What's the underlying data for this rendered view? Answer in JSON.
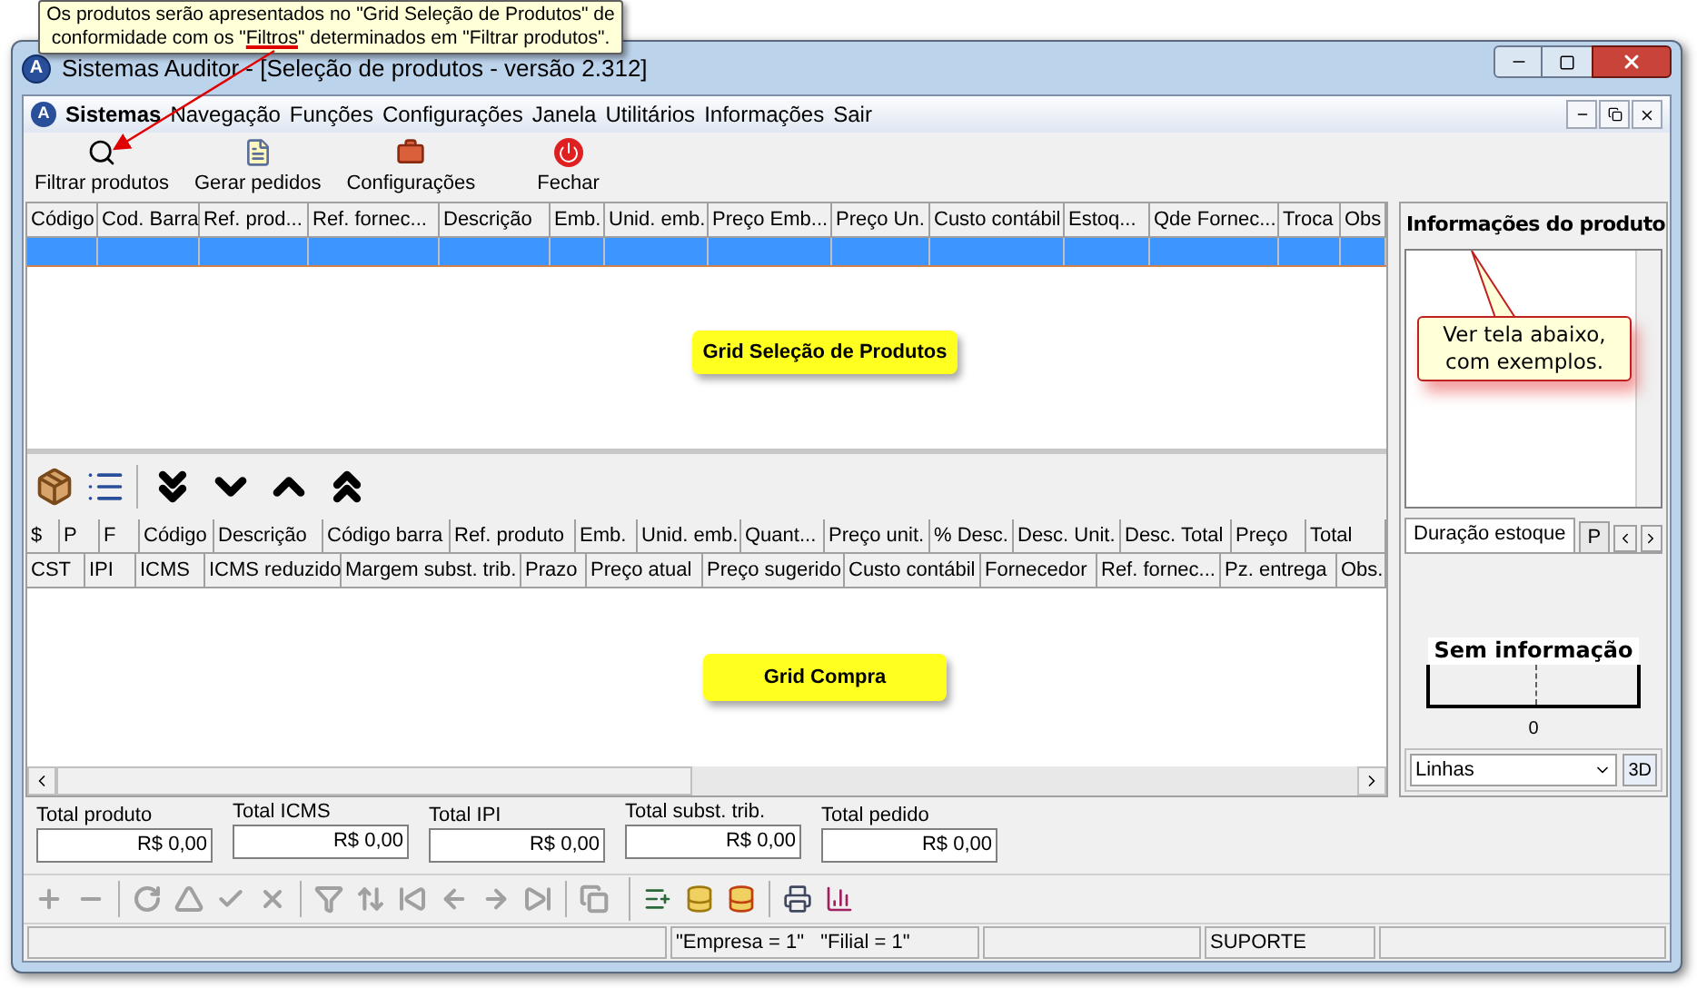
{
  "callout": {
    "parts": [
      {
        "text": "Os produtos serão apresentados no \"Grid Seleção de Produtos\" de conformidade com os \"",
        "underline": false
      },
      {
        "text": "Filtros",
        "underline": true
      },
      {
        "text": "\" determinados  em \"Filtrar produtos\".",
        "underline": false
      }
    ]
  },
  "window": {
    "logo": "A",
    "title": "Sistemas Auditor - [Seleção de produtos - versão 2.312]"
  },
  "menu_logo": "A",
  "menu": [
    {
      "label": "Sistemas",
      "bold": true
    },
    {
      "label": "Navegação",
      "bold": false
    },
    {
      "label": "Funções",
      "bold": false
    },
    {
      "label": "Configurações",
      "bold": false
    },
    {
      "label": "Janela",
      "bold": false
    },
    {
      "label": "Utilitários",
      "bold": false
    },
    {
      "label": "Informações",
      "bold": false
    },
    {
      "label": "Sair",
      "bold": false
    }
  ],
  "toolbar": [
    {
      "label": "Filtrar produtos",
      "kind": "search"
    },
    {
      "label": "Gerar pedidos",
      "kind": "new"
    },
    {
      "label": "Configurações",
      "kind": "settings"
    },
    {
      "label": "Fechar",
      "kind": "close"
    }
  ],
  "grid_selecao": {
    "columns": [
      "Código",
      "Cod. Barra",
      "Ref. prod...",
      "Ref. fornec...",
      "Descrição",
      "Emb.",
      "Unid. emb.",
      "Preço Emb...",
      "Preço Un.",
      "Custo contábil",
      "Estoq...",
      "Qde Fornec...",
      "Troca",
      "Obs"
    ],
    "rows": [
      {
        "selected": true
      }
    ],
    "label": "Grid Seleção de Produtos"
  },
  "grid_compra": {
    "header_row_1": [
      "$",
      "P",
      "F",
      "Código",
      "Descrição",
      "Código barra",
      "Ref. produto",
      "Emb.",
      "Unid. emb.",
      "Quant...",
      "Preço unit.",
      "% Desc.",
      "Desc. Unit.",
      "Desc. Total",
      "Preço",
      "Total"
    ],
    "header_row_2": [
      "CST",
      "IPI",
      "ICMS",
      "ICMS reduzido",
      "Margem subst. trib.",
      "Prazo",
      "Preço atual",
      "Preço sugerido",
      "Custo contábil",
      "Fornecedor",
      "Ref. fornec...",
      "Pz. entrega",
      "Obs."
    ],
    "label": "Grid Compra"
  },
  "product_info": {
    "title": "Informações do produto",
    "note": "Ver tela abaixo, com exemplos.",
    "tabs": [
      {
        "label": "Duração estoque",
        "selected": true
      },
      {
        "label": "P",
        "selected": false
      }
    ],
    "chart": {
      "title": "Sem informação",
      "tick": "0"
    },
    "chart_style": "Linhas",
    "button_3d": "3D"
  },
  "totals": [
    {
      "label": "Total produto",
      "value": "R$ 0,00"
    },
    {
      "label": "Total ICMS",
      "value": "R$ 0,00"
    },
    {
      "label": "Total IPI",
      "value": "R$ 0,00"
    },
    {
      "label": "Total subst. trib.",
      "value": "R$ 0,00"
    },
    {
      "label": "Total pedido",
      "value": "R$ 0,00"
    }
  ],
  "status_bar": {
    "company": "\"Empresa = 1\"   \"Filial = 1\"",
    "user": "SUPORTE"
  }
}
